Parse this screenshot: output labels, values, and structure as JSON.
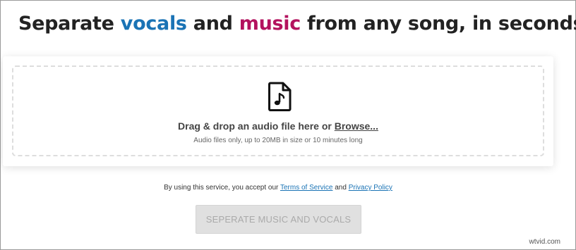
{
  "headline": {
    "part1": "Separate ",
    "word1": "vocals",
    "part2": " and ",
    "word2": "music",
    "part3": " from any song, in seconds!"
  },
  "dropzone": {
    "icon": "music-file-icon",
    "prompt": "Drag & drop an audio file here or ",
    "browse_label": "Browse...",
    "hint": "Audio files only, up to 20MB in size or 10 minutes long"
  },
  "terms": {
    "prefix": "By using this service, you accept our ",
    "tos_label": "Terms of Service",
    "and": " and ",
    "privacy_label": "Privacy Policy"
  },
  "submit": {
    "label": "SEPERATE MUSIC AND VOCALS",
    "disabled": true
  },
  "watermark": "wtvid.com",
  "colors": {
    "vocals": "#1a73b5",
    "music": "#b3125e",
    "link": "#1a73b5",
    "button_bg": "#e0e0e0",
    "button_text": "#aaaaaa"
  }
}
